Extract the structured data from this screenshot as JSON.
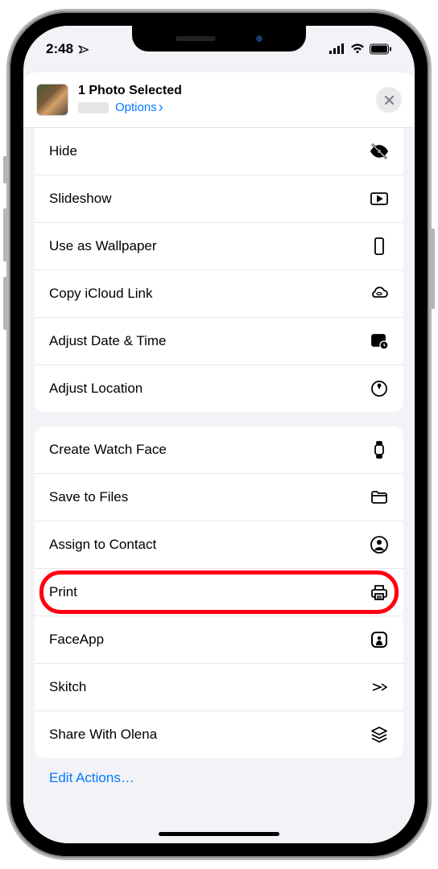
{
  "status": {
    "time": "2:48",
    "location_arrow": "➤"
  },
  "sheet": {
    "title": "1 Photo Selected",
    "options_label": "Options",
    "chevron": "›",
    "close": "✕"
  },
  "group1": [
    {
      "id": "hide",
      "label": "Hide",
      "icon": "eye-slash-icon"
    },
    {
      "id": "slideshow",
      "label": "Slideshow",
      "icon": "play-rect-icon"
    },
    {
      "id": "wallpaper",
      "label": "Use as Wallpaper",
      "icon": "phone-icon"
    },
    {
      "id": "icloud",
      "label": "Copy iCloud Link",
      "icon": "cloud-link-icon"
    },
    {
      "id": "datetime",
      "label": "Adjust Date & Time",
      "icon": "calendar-clock-icon"
    },
    {
      "id": "location",
      "label": "Adjust Location",
      "icon": "map-pin-icon"
    }
  ],
  "group2": [
    {
      "id": "watchface",
      "label": "Create Watch Face",
      "icon": "watch-icon"
    },
    {
      "id": "save",
      "label": "Save to Files",
      "icon": "folder-icon"
    },
    {
      "id": "contact",
      "label": "Assign to Contact",
      "icon": "person-circle-icon"
    },
    {
      "id": "print",
      "label": "Print",
      "icon": "printer-icon",
      "highlighted": true
    },
    {
      "id": "faceapp",
      "label": "FaceApp",
      "icon": "faceapp-icon"
    },
    {
      "id": "skitch",
      "label": "Skitch",
      "icon": "skitch-icon"
    },
    {
      "id": "olena",
      "label": "Share With Olena",
      "icon": "stack-icon"
    }
  ],
  "edit_actions": "Edit Actions…"
}
